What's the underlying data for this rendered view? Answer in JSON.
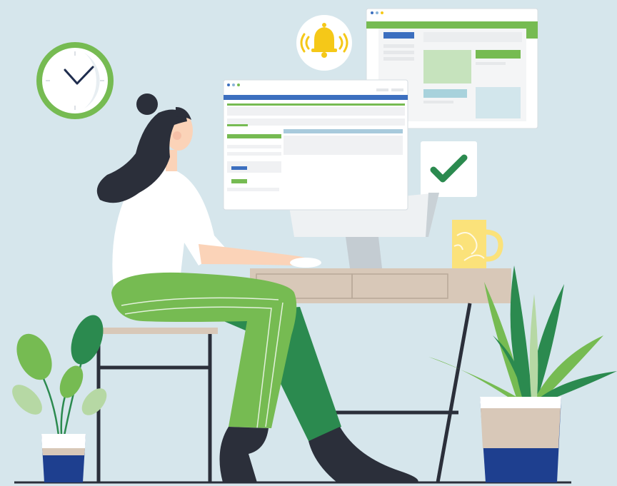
{
  "scene": {
    "subject": "woman-working-at-desk",
    "elements": {
      "wall_clock": {
        "icon": "clock-icon"
      },
      "notification": {
        "icon": "bell-icon"
      },
      "task_status": {
        "icon": "checkmark-icon"
      },
      "browser_window_back": {
        "icon": "browser-window-icon"
      },
      "browser_window_front": {
        "icon": "browser-window-icon"
      },
      "monitor": {
        "icon": "monitor-icon"
      },
      "mug": {
        "icon": "mug-icon"
      },
      "desk": {
        "icon": "desk-icon"
      },
      "stool": {
        "icon": "stool-icon"
      },
      "plant_left": {
        "icon": "potted-plant-icon"
      },
      "plant_right": {
        "icon": "potted-plant-icon"
      }
    }
  },
  "colors": {
    "background": "#d6e6ec",
    "brand_green": "#76bb52",
    "dark_green": "#2b8a4f",
    "brand_blue": "#3c6fbf",
    "pot_blue": "#1e3f8f",
    "bell_yellow": "#f5c818",
    "hair": "#2b2f3a",
    "skin": "#fbd3b8",
    "desk_top": "#d8c8b8",
    "mug_yellow": "#fbe27a"
  }
}
